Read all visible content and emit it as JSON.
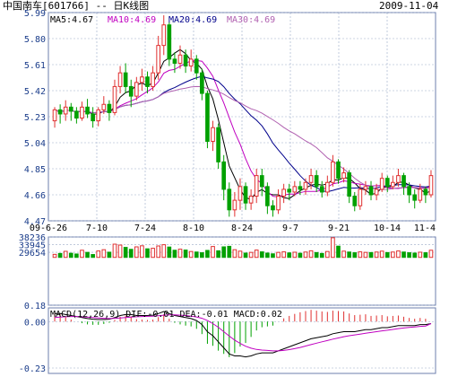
{
  "header": {
    "title": "中国南车[601766] -- 日K线图",
    "date": "2009-11-04"
  },
  "price_panel": {
    "ma_labels": [
      "MA5:4.67",
      "MA10:4.69",
      "MA20:4.69",
      "MA30:4.69"
    ],
    "y_ticks": [
      "5.99",
      "5.80",
      "5.61",
      "5.42",
      "5.23",
      "5.04",
      "4.85",
      "4.66",
      "4.47"
    ],
    "x_ticks": [
      "09-6-26",
      "7-10",
      "7-24",
      "8-10",
      "8-24",
      "9-7",
      "9-21",
      "10-14",
      "11-4"
    ]
  },
  "volume_panel": {
    "y_ticks": [
      "38236",
      "33945",
      "29654",
      "0.18"
    ]
  },
  "macd_panel": {
    "label": "MACD(12,26,9) DIF:-0.01 DEA:-0.01 MACD:0.02",
    "y_ticks": [
      "0.00",
      "-0.23"
    ]
  },
  "colors": {
    "up": "#e03030",
    "down": "#00a000",
    "grid": "#9aa9c8",
    "ma5": "#000000",
    "ma10": "#c000c0",
    "ma20": "#00008b",
    "ma30": "#b060b0",
    "axis_text": "#1a3c8a"
  },
  "chart_data": {
    "type": "candlestick",
    "x_labels": [
      "09-6-26",
      "7-10",
      "7-24",
      "8-10",
      "8-24",
      "9-7",
      "9-21",
      "10-14",
      "11-4"
    ],
    "price_range": [
      4.47,
      5.99
    ],
    "candles": [
      [
        5.2,
        5.28,
        5.3,
        5.15
      ],
      [
        5.28,
        5.25,
        5.32,
        5.18
      ],
      [
        5.25,
        5.3,
        5.35,
        5.2
      ],
      [
        5.3,
        5.27,
        5.33,
        5.2
      ],
      [
        5.27,
        5.22,
        5.3,
        5.18
      ],
      [
        5.22,
        5.3,
        5.34,
        5.2
      ],
      [
        5.3,
        5.25,
        5.36,
        5.22
      ],
      [
        5.25,
        5.2,
        5.3,
        5.15
      ],
      [
        5.2,
        5.28,
        5.3,
        5.16
      ],
      [
        5.28,
        5.32,
        5.38,
        5.25
      ],
      [
        5.32,
        5.26,
        5.35,
        5.2
      ],
      [
        5.26,
        5.45,
        5.5,
        5.24
      ],
      [
        5.45,
        5.55,
        5.6,
        5.4
      ],
      [
        5.55,
        5.45,
        5.62,
        5.4
      ],
      [
        5.45,
        5.38,
        5.5,
        5.3
      ],
      [
        5.38,
        5.48,
        5.52,
        5.35
      ],
      [
        5.48,
        5.52,
        5.58,
        5.42
      ],
      [
        5.52,
        5.45,
        5.56,
        5.4
      ],
      [
        5.45,
        5.55,
        5.6,
        5.42
      ],
      [
        5.55,
        5.75,
        5.82,
        5.5
      ],
      [
        5.75,
        5.9,
        5.97,
        5.68
      ],
      [
        5.9,
        5.65,
        5.92,
        5.6
      ],
      [
        5.65,
        5.62,
        5.7,
        5.55
      ],
      [
        5.62,
        5.68,
        5.75,
        5.58
      ],
      [
        5.68,
        5.6,
        5.72,
        5.55
      ],
      [
        5.6,
        5.65,
        5.72,
        5.56
      ],
      [
        5.65,
        5.55,
        5.68,
        5.5
      ],
      [
        5.55,
        5.4,
        5.58,
        5.35
      ],
      [
        5.4,
        5.05,
        5.42,
        5.0
      ],
      [
        5.05,
        5.15,
        5.2,
        4.98
      ],
      [
        5.15,
        4.9,
        5.18,
        4.85
      ],
      [
        4.9,
        4.7,
        4.95,
        4.62
      ],
      [
        4.7,
        4.55,
        4.75,
        4.5
      ],
      [
        4.55,
        4.62,
        4.68,
        4.5
      ],
      [
        4.62,
        4.72,
        4.78,
        4.55
      ],
      [
        4.72,
        4.6,
        4.75,
        4.55
      ],
      [
        4.6,
        4.65,
        4.7,
        4.55
      ],
      [
        4.65,
        4.8,
        4.85,
        4.6
      ],
      [
        4.8,
        4.72,
        4.85,
        4.65
      ],
      [
        4.72,
        4.58,
        4.75,
        4.52
      ],
      [
        4.58,
        4.55,
        4.62,
        4.5
      ],
      [
        4.55,
        4.65,
        4.7,
        4.52
      ],
      [
        4.65,
        4.7,
        4.74,
        4.6
      ],
      [
        4.7,
        4.68,
        4.74,
        4.62
      ],
      [
        4.68,
        4.72,
        4.76,
        4.65
      ],
      [
        4.72,
        4.7,
        4.76,
        4.66
      ],
      [
        4.7,
        4.75,
        4.78,
        4.66
      ],
      [
        4.75,
        4.8,
        4.85,
        4.7
      ],
      [
        4.8,
        4.72,
        4.84,
        4.68
      ],
      [
        4.72,
        4.68,
        4.76,
        4.64
      ],
      [
        4.68,
        4.75,
        4.8,
        4.65
      ],
      [
        4.75,
        4.9,
        4.95,
        4.72
      ],
      [
        4.9,
        4.78,
        4.92,
        4.74
      ],
      [
        4.78,
        4.82,
        4.86,
        4.75
      ],
      [
        4.82,
        4.65,
        4.84,
        4.6
      ],
      [
        4.65,
        4.58,
        4.68,
        4.54
      ],
      [
        4.58,
        4.7,
        4.74,
        4.55
      ],
      [
        4.7,
        4.72,
        4.76,
        4.66
      ],
      [
        4.72,
        4.66,
        4.76,
        4.62
      ],
      [
        4.66,
        4.7,
        4.74,
        4.62
      ],
      [
        4.7,
        4.78,
        4.82,
        4.68
      ],
      [
        4.78,
        4.72,
        4.8,
        4.68
      ],
      [
        4.72,
        4.75,
        4.8,
        4.7
      ],
      [
        4.75,
        4.8,
        4.85,
        4.72
      ],
      [
        4.8,
        4.72,
        4.82,
        4.66
      ],
      [
        4.72,
        4.66,
        4.75,
        4.6
      ],
      [
        4.66,
        4.62,
        4.7,
        4.56
      ],
      [
        4.62,
        4.7,
        4.74,
        4.6
      ],
      [
        4.7,
        4.66,
        4.72,
        4.6
      ],
      [
        4.66,
        4.8,
        4.84,
        4.64
      ]
    ],
    "volume_range": [
      0.18,
      38236
    ],
    "volumes": [
      28500,
      29000,
      30200,
      29100,
      28700,
      30800,
      29600,
      28400,
      30400,
      31100,
      29700,
      34200,
      33700,
      32400,
      31300,
      32700,
      33300,
      31600,
      31900,
      33200,
      33900,
      32600,
      30800,
      31400,
      30900,
      30100,
      29800,
      29400,
      30700,
      32900,
      30500,
      32700,
      33000,
      31100,
      30300,
      29200,
      29600,
      30900,
      29900,
      29200,
      28800,
      29600,
      29900,
      29300,
      29700,
      29100,
      29800,
      30500,
      29500,
      29000,
      30100,
      37800,
      33100,
      30300,
      29800,
      29400,
      29900,
      29600,
      29500,
      29800,
      30300,
      29500,
      29800,
      30400,
      29800,
      29400,
      29200,
      29700,
      29400,
      30800
    ],
    "macd_range": [
      -0.23,
      0.05
    ],
    "macd": {
      "dif": [
        0.04,
        0.04,
        0.035,
        0.03,
        0.025,
        0.02,
        0.015,
        0.012,
        0.01,
        0.01,
        0.012,
        0.02,
        0.03,
        0.035,
        0.035,
        0.03,
        0.03,
        0.03,
        0.032,
        0.04,
        0.05,
        0.04,
        0.03,
        0.025,
        0.02,
        0.015,
        0.005,
        -0.015,
        -0.05,
        -0.07,
        -0.1,
        -0.13,
        -0.16,
        -0.17,
        -0.17,
        -0.175,
        -0.17,
        -0.16,
        -0.155,
        -0.155,
        -0.155,
        -0.145,
        -0.135,
        -0.125,
        -0.115,
        -0.105,
        -0.095,
        -0.085,
        -0.08,
        -0.075,
        -0.07,
        -0.06,
        -0.055,
        -0.05,
        -0.05,
        -0.05,
        -0.045,
        -0.04,
        -0.04,
        -0.035,
        -0.03,
        -0.03,
        -0.025,
        -0.02,
        -0.02,
        -0.02,
        -0.02,
        -0.015,
        -0.015,
        -0.01
      ],
      "dea": [
        0.02,
        0.022,
        0.024,
        0.025,
        0.025,
        0.024,
        0.022,
        0.02,
        0.018,
        0.016,
        0.015,
        0.016,
        0.018,
        0.02,
        0.022,
        0.024,
        0.025,
        0.026,
        0.027,
        0.029,
        0.032,
        0.033,
        0.033,
        0.032,
        0.03,
        0.027,
        0.023,
        0.016,
        0.005,
        -0.01,
        -0.028,
        -0.05,
        -0.072,
        -0.092,
        -0.108,
        -0.122,
        -0.132,
        -0.138,
        -0.141,
        -0.143,
        -0.145,
        -0.145,
        -0.143,
        -0.139,
        -0.134,
        -0.128,
        -0.121,
        -0.114,
        -0.107,
        -0.1,
        -0.094,
        -0.087,
        -0.081,
        -0.075,
        -0.07,
        -0.066,
        -0.062,
        -0.058,
        -0.054,
        -0.05,
        -0.046,
        -0.043,
        -0.039,
        -0.035,
        -0.032,
        -0.029,
        -0.027,
        -0.024,
        -0.022,
        -0.01
      ]
    }
  }
}
